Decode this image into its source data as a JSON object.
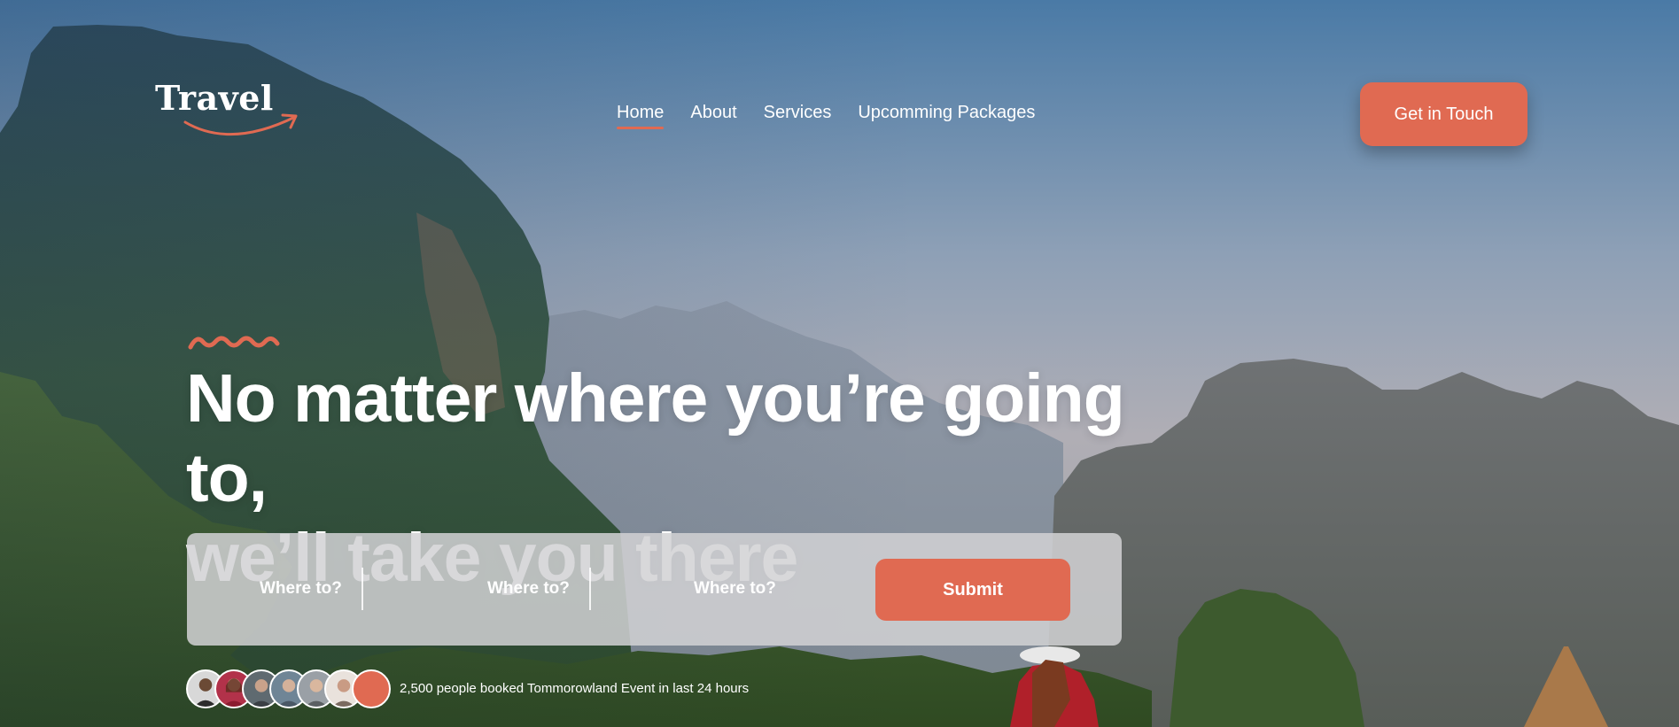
{
  "brand": {
    "logo_text": "Travel",
    "accent_color": "#e06a52"
  },
  "nav": {
    "items": [
      {
        "label": "Home",
        "active": true
      },
      {
        "label": "About",
        "active": false
      },
      {
        "label": "Services",
        "active": false
      },
      {
        "label": "Upcomming Packages",
        "active": false
      }
    ]
  },
  "header": {
    "cta_label": "Get in Touch"
  },
  "hero": {
    "headline_line1": "No matter where you’re going to,",
    "headline_line2": "we’ll take you there"
  },
  "search": {
    "fields": [
      {
        "label": "Where to?"
      },
      {
        "label": "Where to?"
      },
      {
        "label": "Where to?"
      }
    ],
    "submit_label": "Submit"
  },
  "social_proof": {
    "avatar_count": 7,
    "text": "2,500 people booked Tommorowland Event in last 24 hours"
  }
}
